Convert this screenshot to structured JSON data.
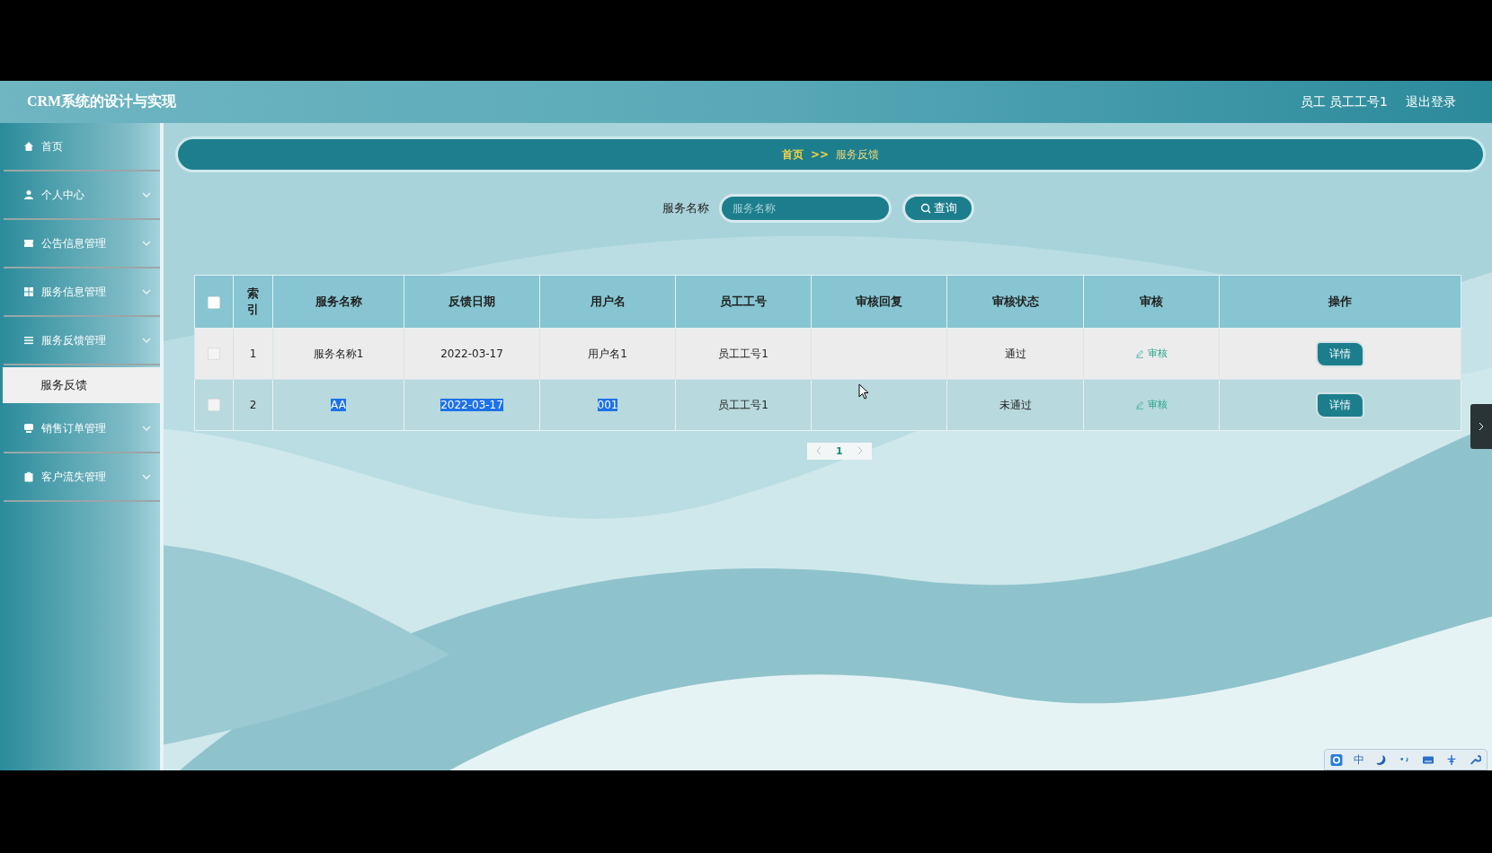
{
  "header": {
    "title": "CRM系统的设计与实现",
    "user_role": "员工",
    "user_name": "员工工号1",
    "logout": "退出登录"
  },
  "sidebar": {
    "items": [
      {
        "label": "首页",
        "kind": "link"
      },
      {
        "label": "个人中心",
        "kind": "menu"
      },
      {
        "label": "公告信息管理",
        "kind": "menu"
      },
      {
        "label": "服务信息管理",
        "kind": "menu"
      },
      {
        "label": "服务反馈管理",
        "kind": "menu",
        "children": [
          {
            "label": "服务反馈",
            "selected": true
          }
        ]
      },
      {
        "label": "销售订单管理",
        "kind": "menu"
      },
      {
        "label": "客户流失管理",
        "kind": "menu"
      }
    ]
  },
  "breadcrumb": {
    "items": [
      "首页",
      "服务反馈"
    ],
    "separator": ">>"
  },
  "search": {
    "label": "服务名称",
    "placeholder": "服务名称",
    "button": "查询"
  },
  "table": {
    "select_all": {
      "checked": false
    },
    "columns": [
      "索引",
      "服务名称",
      "反馈日期",
      "用户名",
      "员工工号",
      "审核回复",
      "审核状态",
      "审核",
      "操作"
    ],
    "rows": [
      {
        "checked": false,
        "highlighted": false,
        "cells": [
          {
            "text": "1",
            "text_selected": false
          },
          {
            "text": "服务名称1",
            "text_selected": false
          },
          {
            "text": "2022-03-17",
            "text_selected": false
          },
          {
            "text": "用户名1",
            "text_selected": false
          },
          {
            "text": "员工工号1",
            "text_selected": false
          },
          {
            "text": "通过",
            "text_selected": false
          }
        ],
        "review_link": "审核",
        "detail_button": "详情"
      },
      {
        "checked": false,
        "highlighted": true,
        "cells": [
          {
            "text": "2",
            "text_selected": false
          },
          {
            "text": "AA",
            "text_selected": true
          },
          {
            "text": "2022-03-17",
            "text_selected": true
          },
          {
            "text": "001",
            "text_selected": true
          },
          {
            "text": "员工工号1",
            "text_selected": false
          },
          {
            "text": "未通过",
            "text_selected": false
          }
        ],
        "review_link": "审核",
        "detail_button": "详情"
      }
    ]
  },
  "pagination": {
    "pages": [
      {
        "label": "1",
        "selected": true
      }
    ]
  },
  "ime_toolbar": {
    "language": "中"
  }
}
